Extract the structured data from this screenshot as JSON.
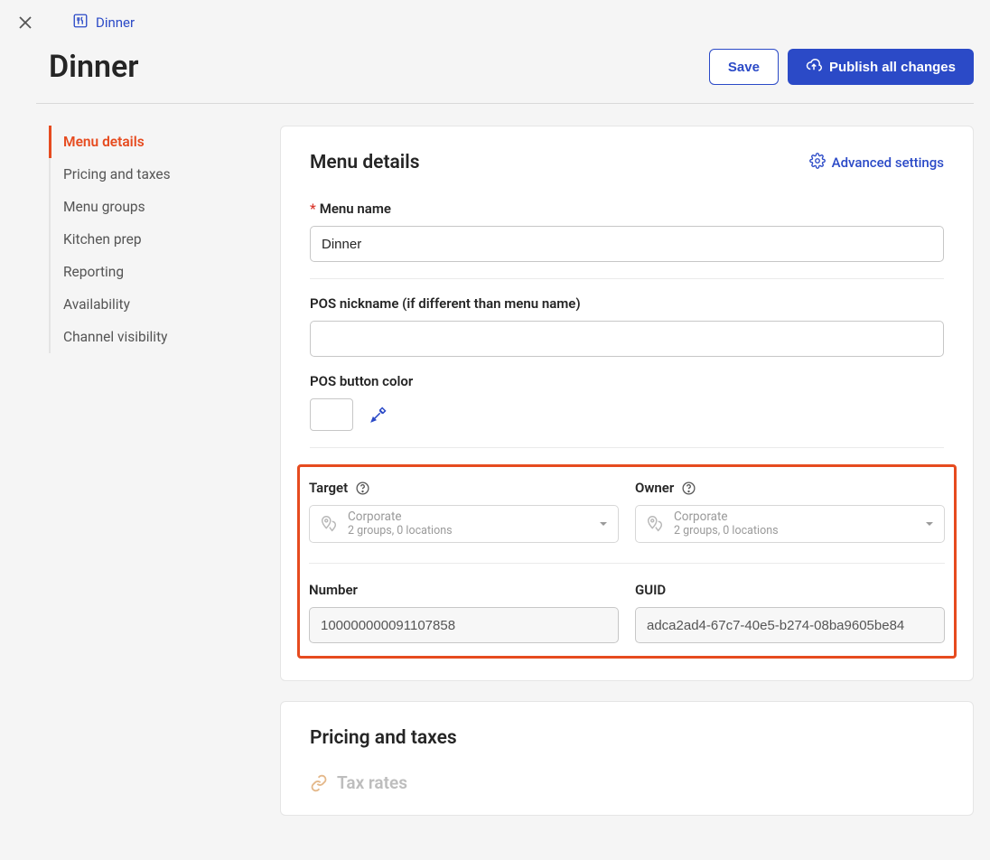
{
  "breadcrumb": {
    "label": "Dinner"
  },
  "page": {
    "title": "Dinner"
  },
  "actions": {
    "save": "Save",
    "publish": "Publish all changes"
  },
  "sidebar": {
    "items": [
      {
        "label": "Menu details",
        "active": true
      },
      {
        "label": "Pricing and taxes",
        "active": false
      },
      {
        "label": "Menu groups",
        "active": false
      },
      {
        "label": "Kitchen prep",
        "active": false
      },
      {
        "label": "Reporting",
        "active": false
      },
      {
        "label": "Availability",
        "active": false
      },
      {
        "label": "Channel visibility",
        "active": false
      }
    ]
  },
  "details": {
    "heading": "Menu details",
    "advanced": "Advanced settings",
    "menu_name_label": "Menu name",
    "menu_name_value": "Dinner",
    "pos_nickname_label": "POS nickname (if different than menu name)",
    "pos_nickname_value": "",
    "pos_color_label": "POS button color",
    "target_label": "Target",
    "owner_label": "Owner",
    "target_select": {
      "title": "Corporate",
      "sub": "2 groups, 0 locations"
    },
    "owner_select": {
      "title": "Corporate",
      "sub": "2 groups, 0 locations"
    },
    "number_label": "Number",
    "number_value": "100000000091107858",
    "guid_label": "GUID",
    "guid_value": "adca2ad4-67c7-40e5-b274-08ba9605be84"
  },
  "pricing": {
    "heading": "Pricing and taxes",
    "tax_rates": "Tax rates"
  }
}
